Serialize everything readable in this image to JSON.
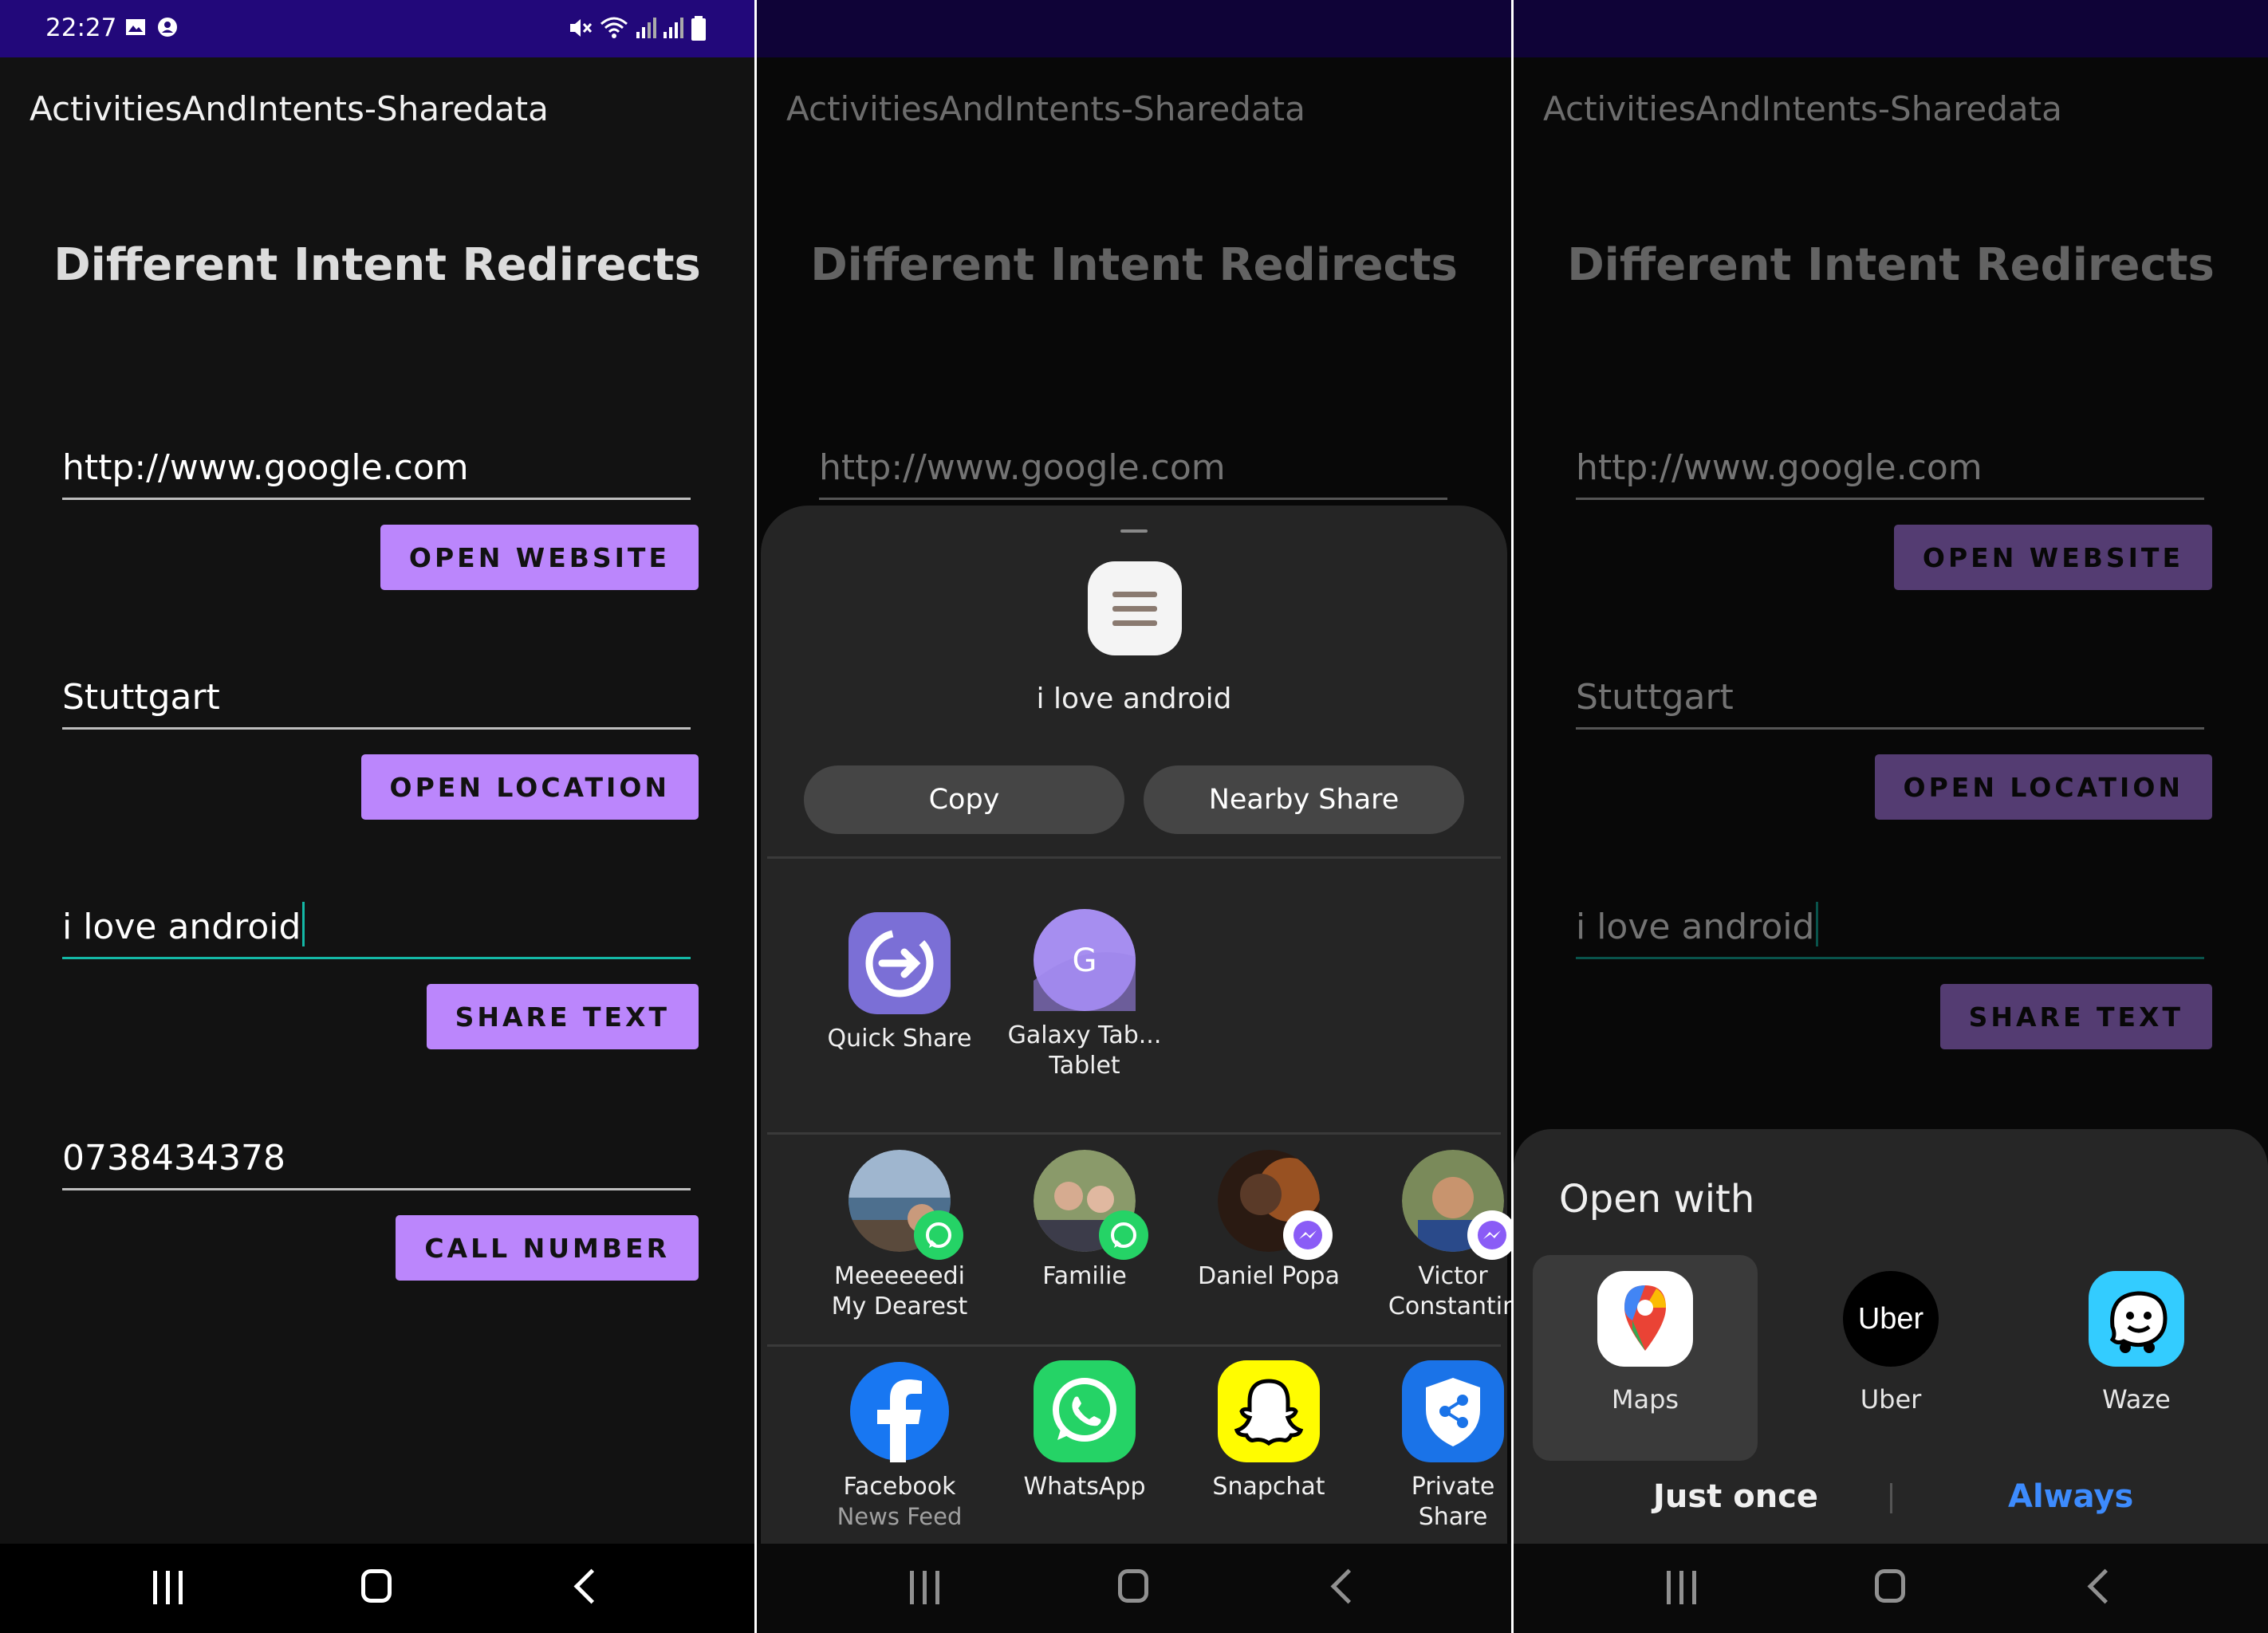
{
  "status": {
    "time": "22:27"
  },
  "app": {
    "title": "ActivitiesAndIntents-Sharedata",
    "heading": "Different Intent Redirects",
    "website_field": "http://www.google.com",
    "open_website_label": "OPEN WEBSITE",
    "location_field": "Stuttgart",
    "open_location_label": "OPEN LOCATION",
    "share_field": "i love android",
    "share_text_label": "SHARE TEXT",
    "phone_field": "0738434378",
    "call_number_label": "CALL NUMBER"
  },
  "share_sheet": {
    "preview_text": "i love android",
    "copy_label": "Copy",
    "nearby_label": "Nearby Share",
    "direct": [
      {
        "label": "Quick Share",
        "sub": ""
      },
      {
        "label": "Galaxy Tab...",
        "sub": "Tablet",
        "initial": "G"
      }
    ],
    "contacts": [
      {
        "label": "Meeeeeedi",
        "sub": "My Dearest",
        "badge": "whatsapp-badge"
      },
      {
        "label": "Familie",
        "sub": "",
        "badge": "whatsapp-badge"
      },
      {
        "label": "Daniel Popa",
        "sub": "",
        "badge": "messenger-badge"
      },
      {
        "label": "Victor",
        "sub": "Constantin",
        "badge": "messenger-badge"
      }
    ],
    "apps": [
      {
        "label": "Facebook",
        "sub": "News Feed",
        "icon": "facebook-icon"
      },
      {
        "label": "WhatsApp",
        "sub": "",
        "icon": "whatsapp-icon"
      },
      {
        "label": "Snapchat",
        "sub": "",
        "icon": "snapchat-icon"
      },
      {
        "label": "Private",
        "sub": "Share",
        "icon": "private-share-icon"
      }
    ]
  },
  "open_with": {
    "title": "Open with",
    "apps": [
      {
        "label": "Maps",
        "icon": "google-maps-icon"
      },
      {
        "label": "Uber",
        "icon": "uber-icon",
        "icon_text": "Uber"
      },
      {
        "label": "Waze",
        "icon": "waze-icon"
      }
    ],
    "just_once": "Just once",
    "always": "Always"
  },
  "colors": {
    "status_bar": "#22087a",
    "button": "#bb86fc",
    "focus_underline": "#14b8a6",
    "always_link": "#3d8bfd"
  }
}
